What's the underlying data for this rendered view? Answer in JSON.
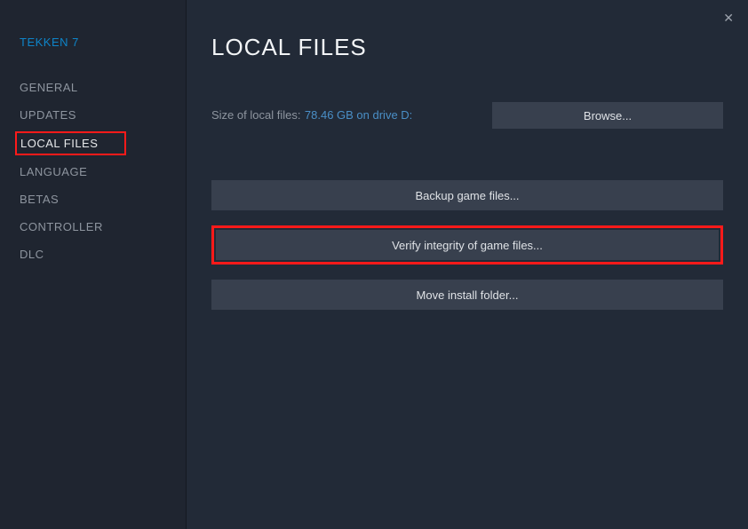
{
  "sidebar": {
    "game_title": "TEKKEN 7",
    "items": [
      {
        "label": "GENERAL"
      },
      {
        "label": "UPDATES"
      },
      {
        "label": "LOCAL FILES"
      },
      {
        "label": "LANGUAGE"
      },
      {
        "label": "BETAS"
      },
      {
        "label": "CONTROLLER"
      },
      {
        "label": "DLC"
      }
    ]
  },
  "content": {
    "title": "LOCAL FILES",
    "size_label": "Size of local files:",
    "size_value": "78.46 GB on drive D:",
    "browse_label": "Browse...",
    "backup_label": "Backup game files...",
    "verify_label": "Verify integrity of game files...",
    "move_label": "Move install folder..."
  }
}
